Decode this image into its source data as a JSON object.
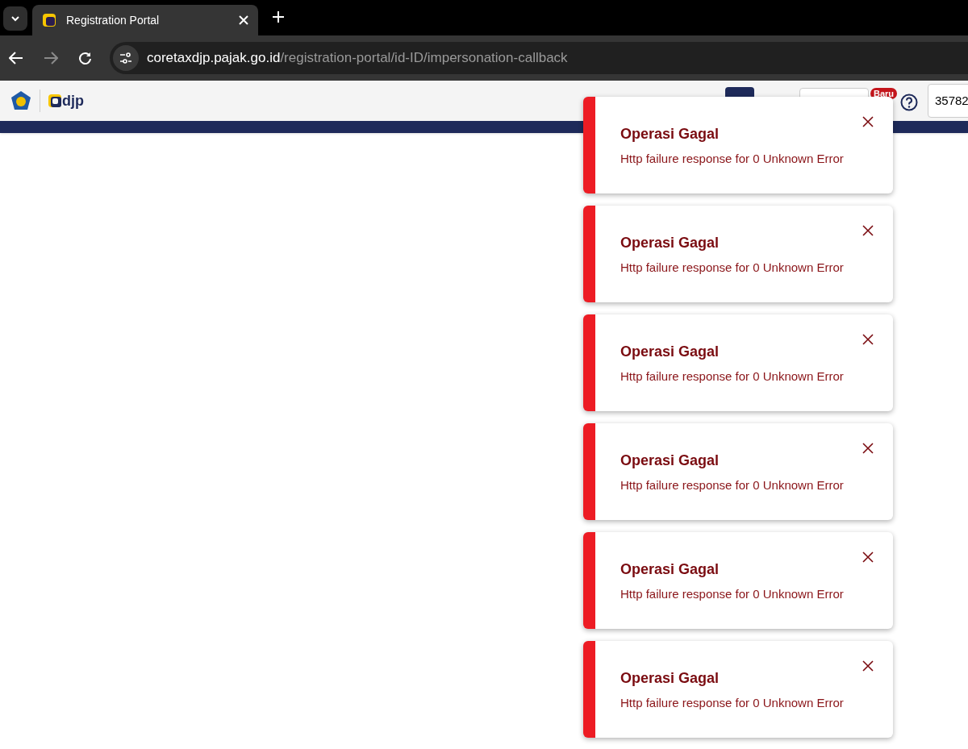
{
  "browser": {
    "tab_title": "Registration Portal",
    "url_host": "coretaxdjp.pajak.go.id",
    "url_path": "/registration-portal/id-ID/impersonation-callback"
  },
  "header": {
    "logo_text": "djp",
    "badge": "Baru",
    "user_field_value": "35782"
  },
  "toasts": [
    {
      "title": "Operasi Gagal",
      "message": "Http failure response for 0 Unknown Error"
    },
    {
      "title": "Operasi Gagal",
      "message": "Http failure response for 0 Unknown Error"
    },
    {
      "title": "Operasi Gagal",
      "message": "Http failure response for 0 Unknown Error"
    },
    {
      "title": "Operasi Gagal",
      "message": "Http failure response for 0 Unknown Error"
    },
    {
      "title": "Operasi Gagal",
      "message": "Http failure response for 0 Unknown Error"
    },
    {
      "title": "Operasi Gagal",
      "message": "Http failure response for 0 Unknown Error"
    }
  ]
}
